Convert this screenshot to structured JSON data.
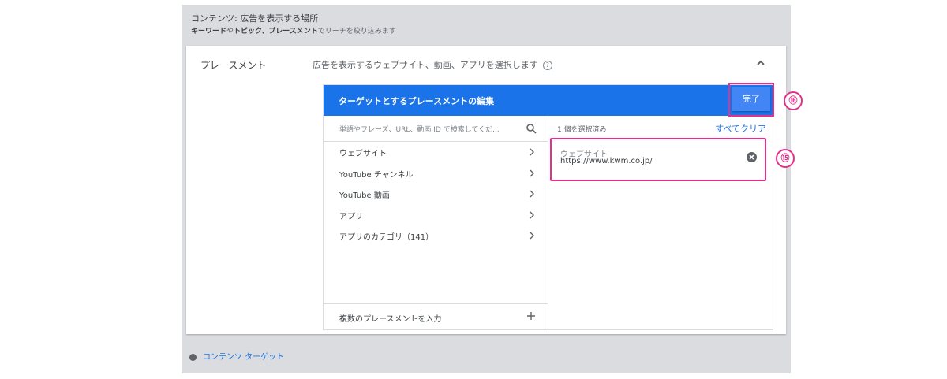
{
  "header": {
    "title": "コンテンツ: 広告を表示する場所",
    "subtitle_bold_1": "キーワード",
    "subtitle_mid_1": "や",
    "subtitle_bold_2": "トピック、プレースメント",
    "subtitle_tail": "でリーチを絞り込みます"
  },
  "section": {
    "label": "プレースメント",
    "description": "広告を表示するウェブサイト、動画、アプリを選択します",
    "help_icon": "?"
  },
  "editor": {
    "title": "ターゲットとするプレースメントの編集",
    "done_label": "完了",
    "search_placeholder": "単語やフレーズ、URL、動画 ID で検索してくだ...",
    "categories": [
      {
        "label": "ウェブサイト"
      },
      {
        "label": "YouTube チャンネル"
      },
      {
        "label": "YouTube 動画"
      },
      {
        "label": "アプリ"
      },
      {
        "label": "アプリのカテゴリ（141）"
      }
    ],
    "multi_input_label": "複数のプレースメントを入力",
    "selected_count": "1 個を選択済み",
    "clear_all_label": "すべてクリア",
    "selected_items": [
      {
        "type": "ウェブサイト",
        "url": "https://www.kwm.co.jp/"
      }
    ]
  },
  "markers": {
    "done": "⑯",
    "selected": "⑮"
  },
  "footer": {
    "link_label": "コンテンツ ターゲット"
  },
  "colors": {
    "accent": "#1a73e8",
    "highlight": "#e2308d",
    "panel_bg": "#dadce0"
  }
}
